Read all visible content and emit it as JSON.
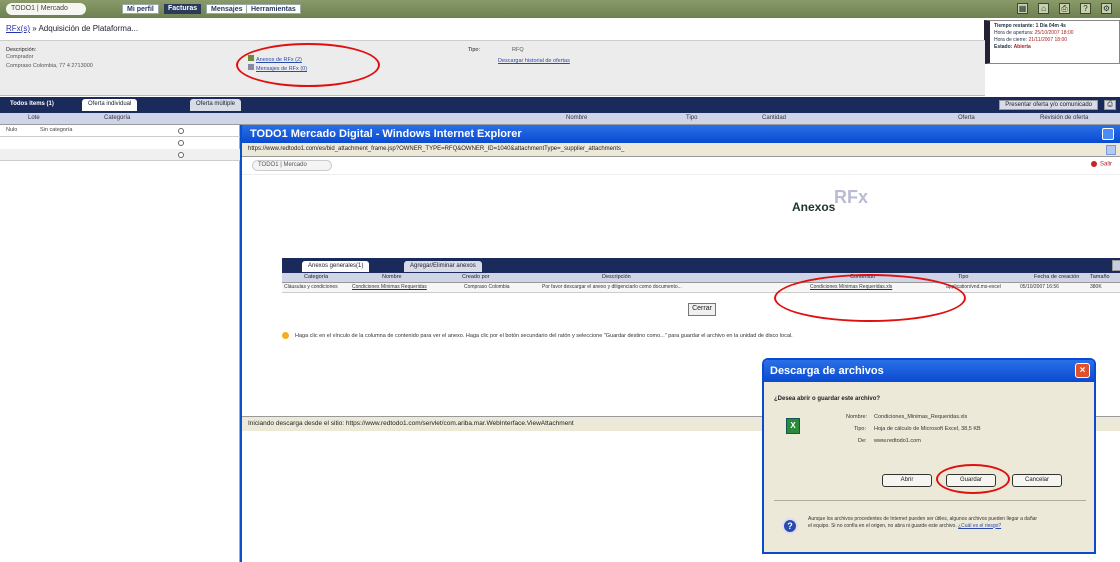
{
  "top": {
    "logo": "TODO1 | Mercado",
    "tabs": [
      "Mi perfil",
      "Facturas",
      "Mensajes",
      "Herramientas"
    ]
  },
  "session": {
    "line1": "Tiempo restante: 1 Día 04m 4s",
    "line2_label": "Hora de apertura:",
    "line2_value": "25/10/2007 18:00",
    "line3_label": "Hora de cierre:",
    "line3_value": "21/11/2007 18:00",
    "line4_label": "Estado:",
    "line4_value": "Abierta"
  },
  "breadcrumb": {
    "prefix": "RFx(s)",
    "sep": " » ",
    "title": "Adquisición de Plataforma..."
  },
  "info": {
    "descr_label": "Descripción:",
    "descr_sub": "Comprador",
    "descr_value": "Compraso Colombia, 77 4 2713000",
    "link1": "Anexos de RFx (2)",
    "link2": "Mensajes de RFx (0)",
    "type_label": "Tipo:",
    "type_value": "RFQ",
    "history_link": "Descargar historial de ofertas"
  },
  "tabs": {
    "todas": "Todos Items (1)",
    "individual": "Oferta individual",
    "multiple": "Oferta múltiple",
    "presentar": "Presentar oferta y/o comunicado"
  },
  "columns": {
    "lote": "Lote",
    "categoria": "Categoría",
    "nombre": "Nombre",
    "tipo": "Tipo",
    "cantidad": "Cantidad",
    "oferta": "Oferta",
    "revision": "Revisión de oferta"
  },
  "left_rows": [
    {
      "lote": "Nulo",
      "categoria": "Sin categoría"
    }
  ],
  "ie": {
    "title": "TODO1 Mercado Digital - Windows Internet Explorer",
    "url": "https://www.redtodo1.com/es/bid_attachment_frame.jsp?OWNER_TYPE=RFQ&OWNER_ID=1040&attachmentType=_supplier_attachments_",
    "logo": "TODO1 | Mercado",
    "salir": "Salir",
    "rfx": "RFx",
    "anexos": "Anexos",
    "status": "Iniciando descarga desde el sitio: https://www.redtodo1.com/servlet/com.ariba.mar.WebInterface.ViewAttachment"
  },
  "annex": {
    "tab1": "Anexos generales(1)",
    "tab2": "Agregar/Eliminar anexos",
    "headers": [
      "Categoría",
      "Nombre",
      "Creado por",
      "Descripción",
      "Contenido",
      "Tipo",
      "Fecha de creación",
      "Tamaño"
    ],
    "row": [
      "Cláusulas y condiciones",
      "Condiciones Mínimas Requeridas",
      "Compraso Colombia",
      "Por favor descargar el anexo y diligenciarlo como documento...",
      "Condiciones Mínimas Requeridas.xls",
      "application/vnd.ms-excel",
      "05/10/2007 16:56",
      "380K"
    ],
    "close": "Cerrar",
    "hint": "Haga clic en el vínculo de la columna de contenido para ver el anexo. Haga clic por el botón secundario del ratón y seleccione \"Guardar destino como...\" para guardar el archivo en la unidad de disco local."
  },
  "dialog": {
    "title": "Descarga de archivos",
    "question": "¿Desea abrir o guardar este archivo?",
    "name_label": "Nombre:",
    "name_value": "Condiciones_Minimas_Requeridas.xls",
    "type_label": "Tipo:",
    "type_value": "Hoja de cálculo de Microsoft Excel, 38,5 KB",
    "from_label": "De:",
    "from_value": "www.redtodo1.com",
    "open": "Abrir",
    "save": "Guardar",
    "cancel": "Cancelar",
    "warning": "Aunque los archivos procedentes de Internet pueden ser útiles, algunos archivos pueden llegar a dañar el equipo. Si no confía en el origen, no abra ni guarde este archivo.",
    "warning_link": "¿Cuál es el riesgo?"
  },
  "colors": {
    "navy": "#1a2a5a",
    "xp_blue": "#0a4ad0",
    "highlight": "#e01010"
  }
}
